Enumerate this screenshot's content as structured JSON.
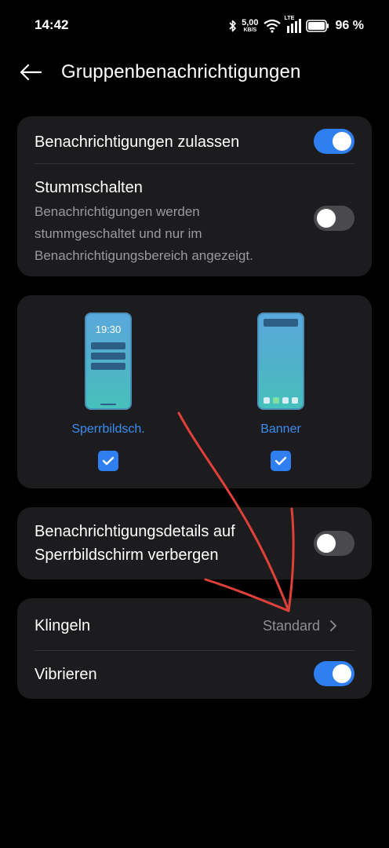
{
  "status_bar": {
    "time": "14:42",
    "net_speed_value": "5,00",
    "net_speed_unit": "KB/S",
    "network_label": "LTE",
    "battery_percent": "96 %",
    "icons": [
      "bluetooth-icon",
      "wifi-icon",
      "signal-icon",
      "battery-icon"
    ]
  },
  "header": {
    "title": "Gruppenbenachrichtigungen"
  },
  "card_notifications": {
    "allow_label": "Benachrichtigungen zulassen",
    "allow_enabled": true,
    "mute_label": "Stummschalten",
    "mute_desc_lines": [
      "Benachrichtigungen werden",
      "stummgeschaltet und nur im",
      "Benachrichtigungsbereich angezeigt."
    ],
    "mute_enabled": false
  },
  "card_styles": {
    "options": [
      {
        "label": "Sperrbildsch.",
        "mock_time": "19:30",
        "checked": true
      },
      {
        "label": "Banner",
        "checked": true
      }
    ]
  },
  "card_lockscreen": {
    "label_lines": [
      "Benachrichtigungsdetails auf",
      "Sperrbildschirm verbergen"
    ],
    "enabled": false
  },
  "card_sound": {
    "ringtone_label": "Klingeln",
    "ringtone_value": "Standard",
    "vibrate_label": "Vibrieren",
    "vibrate_enabled": true
  },
  "colors": {
    "accent": "#2f7ff0",
    "card_bg": "#1c1c1e",
    "annotation_arrow": "#e0403a"
  }
}
